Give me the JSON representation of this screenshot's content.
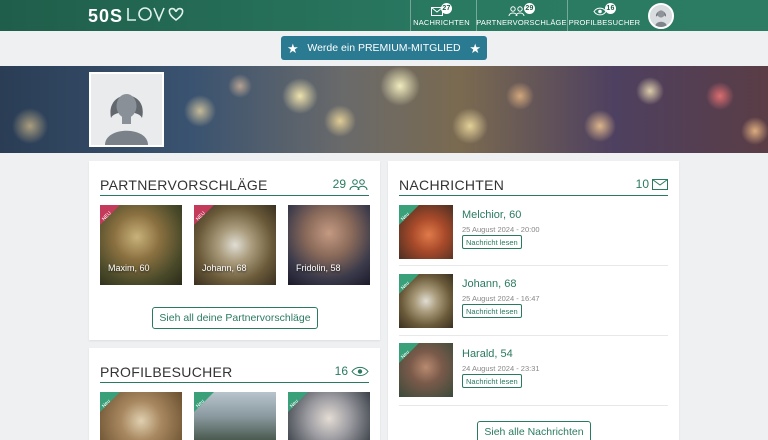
{
  "brand": {
    "num": "50S",
    "word": "LOVE"
  },
  "nav": {
    "messages": {
      "label": "NACHRICHTEN",
      "badge": "27",
      "icon": "envelope-icon"
    },
    "suggestions": {
      "label": "PARTNERVORSCHLÄGE",
      "badge": "29",
      "icon": "couple-icon"
    },
    "visitors": {
      "label": "PROFILBESUCHER",
      "badge": "16",
      "icon": "eye-icon"
    }
  },
  "premium": {
    "label": "Werde ein PREMIUM-MITGLIED"
  },
  "suggestions": {
    "title": "PARTNERVORSCHLÄGE",
    "count": "29",
    "items": [
      {
        "name": "Maxim, 60",
        "ribbon": "NEU"
      },
      {
        "name": "Johann, 68",
        "ribbon": "NEU"
      },
      {
        "name": "Fridolin, 58",
        "ribbon": ""
      }
    ],
    "see_all": "Sieh all deine Partnervorschläge"
  },
  "messages": {
    "title": "NACHRICHTEN",
    "count": "10",
    "items": [
      {
        "name": "Melchior, 60",
        "date": "25 August 2024 - 20:00",
        "action": "Nachricht lesen",
        "ribbon": "Neu"
      },
      {
        "name": "Johann, 68",
        "date": "25 August 2024 - 16:47",
        "action": "Nachricht lesen",
        "ribbon": "Neu"
      },
      {
        "name": "Harald, 54",
        "date": "24 August 2024 - 23:31",
        "action": "Nachricht lesen",
        "ribbon": "Neu"
      }
    ],
    "see_all": "Sieh alle Nachrichten"
  },
  "visitors": {
    "title": "PROFILBESUCHER",
    "count": "16",
    "items": [
      {
        "ribbon": "Neu"
      },
      {
        "ribbon": "Neu"
      },
      {
        "ribbon": "Neu"
      }
    ]
  },
  "colors": {
    "brand": "#2a7a62",
    "premium": "#2a7a92",
    "ribbon_new": "#c43a5a",
    "ribbon_msg": "#3aa07a"
  }
}
